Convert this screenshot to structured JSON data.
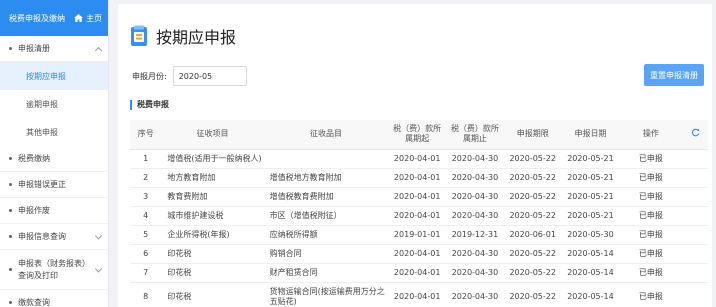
{
  "sidebar": {
    "header_title": "税费申报及缴纳",
    "home_label": "主页",
    "items": [
      {
        "label": "申报清册",
        "expanded": true,
        "children": [
          {
            "label": "按期应申报",
            "active": true
          },
          {
            "label": "逾期申报"
          },
          {
            "label": "其他申报"
          }
        ]
      },
      {
        "label": "税费缴纳"
      },
      {
        "label": "申报错误更正"
      },
      {
        "label": "申报作废"
      },
      {
        "label": "申报信息查询",
        "has_children": true
      },
      {
        "label": "申报表（财务报表）查询及打印",
        "has_children": true
      },
      {
        "label": "缴款查询"
      }
    ]
  },
  "page": {
    "title": "按期应申报",
    "month_label": "申报月份:",
    "month_value": "2020-05",
    "reset_button": "重置申报清册",
    "section_title": "税费申报"
  },
  "table": {
    "headers": [
      "序号",
      "征收项目",
      "征收品目",
      "税（费）款所属期起",
      "税（费）款所属期止",
      "申报期限",
      "申报日期",
      "操作"
    ],
    "rows": [
      [
        "1",
        "增值税(适用于一般纳税人)",
        "",
        "2020-04-01",
        "2020-04-30",
        "2020-05-22",
        "2020-05-21",
        "已申报"
      ],
      [
        "2",
        "地方教育附加",
        "增值税地方教育附加",
        "2020-04-01",
        "2020-04-30",
        "2020-05-22",
        "2020-05-21",
        "已申报"
      ],
      [
        "3",
        "教育费附加",
        "增值税教育费附加",
        "2020-04-01",
        "2020-04-30",
        "2020-05-22",
        "2020-05-21",
        "已申报"
      ],
      [
        "4",
        "城市维护建设税",
        "市区（增值税附征）",
        "2020-04-01",
        "2020-04-30",
        "2020-05-22",
        "2020-05-21",
        "已申报"
      ],
      [
        "5",
        "企业所得税(年报)",
        "应纳税所得额",
        "2019-01-01",
        "2019-12-31",
        "2020-06-01",
        "2020-05-30",
        "已申报"
      ],
      [
        "6",
        "印花税",
        "购销合同",
        "2020-04-01",
        "2020-04-30",
        "2020-05-22",
        "2020-05-14",
        "已申报"
      ],
      [
        "7",
        "印花税",
        "财产租赁合同",
        "2020-04-01",
        "2020-04-30",
        "2020-05-22",
        "2020-05-14",
        "已申报"
      ],
      [
        "8",
        "印花税",
        "货物运输合同(按运输费用万分之五贴花)",
        "2020-04-01",
        "2020-04-30",
        "2020-05-22",
        "2020-05-14",
        "已申报"
      ]
    ]
  },
  "colors": {
    "accent": "#2d8cf0",
    "active_bg": "#e6f1fd",
    "button": "#5ba4f5"
  },
  "icons": [
    "home-icon",
    "document-icon",
    "chevron-icon",
    "refresh-icon"
  ]
}
